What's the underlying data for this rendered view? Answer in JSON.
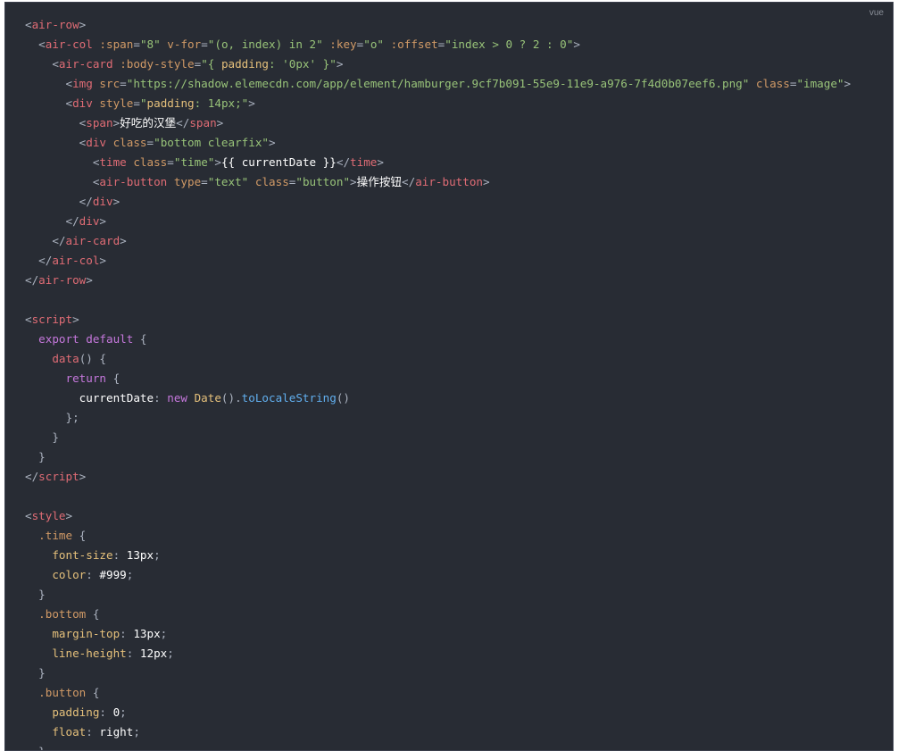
{
  "code_block": {
    "language_label": "vue",
    "colors": {
      "background": "#282c34",
      "tag": "#e06c75",
      "attribute": "#d19a66",
      "string": "#98c379",
      "keyword": "#c678dd",
      "function": "#61afef",
      "property": "#e5c07b",
      "plain": "#abb2bf",
      "text": "#ffffff"
    },
    "lines": [
      [
        [
          "p",
          "<"
        ],
        [
          "tag",
          "air-row"
        ],
        [
          "p",
          ">"
        ]
      ],
      [
        [
          "p",
          "  <"
        ],
        [
          "tag",
          "air-col"
        ],
        [
          "p",
          " "
        ],
        [
          "attr",
          ":span"
        ],
        [
          "p",
          "="
        ],
        [
          "str",
          "\"8\""
        ],
        [
          "p",
          " "
        ],
        [
          "attr",
          "v-for"
        ],
        [
          "p",
          "="
        ],
        [
          "str",
          "\"(o, index) in 2\""
        ],
        [
          "p",
          " "
        ],
        [
          "attr",
          ":key"
        ],
        [
          "p",
          "="
        ],
        [
          "str",
          "\"o\""
        ],
        [
          "p",
          " "
        ],
        [
          "attr",
          ":offset"
        ],
        [
          "p",
          "="
        ],
        [
          "str",
          "\"index > 0 ? 2 : 0\""
        ],
        [
          "p",
          ">"
        ]
      ],
      [
        [
          "p",
          "    <"
        ],
        [
          "tag",
          "air-card"
        ],
        [
          "p",
          " "
        ],
        [
          "attr",
          ":body-style"
        ],
        [
          "p",
          "="
        ],
        [
          "str",
          "\"{ "
        ],
        [
          "prop",
          "padding"
        ],
        [
          "str",
          ": '0px' }\""
        ],
        [
          "p",
          ">"
        ]
      ],
      [
        [
          "p",
          "      <"
        ],
        [
          "tag",
          "img"
        ],
        [
          "p",
          " "
        ],
        [
          "attr",
          "src"
        ],
        [
          "p",
          "="
        ],
        [
          "str",
          "\"https://shadow.elemecdn.com/app/element/hamburger.9cf7b091-55e9-11e9-a976-7f4d0b07eef6.png\""
        ],
        [
          "p",
          " "
        ],
        [
          "attr",
          "class"
        ],
        [
          "p",
          "="
        ],
        [
          "str",
          "\"image\""
        ],
        [
          "p",
          ">"
        ]
      ],
      [
        [
          "p",
          "      <"
        ],
        [
          "tag",
          "div"
        ],
        [
          "p",
          " "
        ],
        [
          "attr",
          "style"
        ],
        [
          "p",
          "="
        ],
        [
          "str",
          "\""
        ],
        [
          "prop",
          "padding"
        ],
        [
          "str",
          ": 14px;\""
        ],
        [
          "p",
          ">"
        ]
      ],
      [
        [
          "p",
          "        <"
        ],
        [
          "tag",
          "span"
        ],
        [
          "p",
          ">"
        ],
        [
          "text",
          "好吃的汉堡"
        ],
        [
          "p",
          "</"
        ],
        [
          "tag",
          "span"
        ],
        [
          "p",
          ">"
        ]
      ],
      [
        [
          "p",
          "        <"
        ],
        [
          "tag",
          "div"
        ],
        [
          "p",
          " "
        ],
        [
          "attr",
          "class"
        ],
        [
          "p",
          "="
        ],
        [
          "str",
          "\"bottom clearfix\""
        ],
        [
          "p",
          ">"
        ]
      ],
      [
        [
          "p",
          "          <"
        ],
        [
          "tag",
          "time"
        ],
        [
          "p",
          " "
        ],
        [
          "attr",
          "class"
        ],
        [
          "p",
          "="
        ],
        [
          "str",
          "\"time\""
        ],
        [
          "p",
          ">"
        ],
        [
          "text",
          "{{ currentDate }}"
        ],
        [
          "p",
          "</"
        ],
        [
          "tag",
          "time"
        ],
        [
          "p",
          ">"
        ]
      ],
      [
        [
          "p",
          "          <"
        ],
        [
          "tag",
          "air-button"
        ],
        [
          "p",
          " "
        ],
        [
          "attr",
          "type"
        ],
        [
          "p",
          "="
        ],
        [
          "str",
          "\"text\""
        ],
        [
          "p",
          " "
        ],
        [
          "attr",
          "class"
        ],
        [
          "p",
          "="
        ],
        [
          "str",
          "\"button\""
        ],
        [
          "p",
          ">"
        ],
        [
          "text",
          "操作按钮"
        ],
        [
          "p",
          "</"
        ],
        [
          "tag",
          "air-button"
        ],
        [
          "p",
          ">"
        ]
      ],
      [
        [
          "p",
          "        </"
        ],
        [
          "tag",
          "div"
        ],
        [
          "p",
          ">"
        ]
      ],
      [
        [
          "p",
          "      </"
        ],
        [
          "tag",
          "div"
        ],
        [
          "p",
          ">"
        ]
      ],
      [
        [
          "p",
          "    </"
        ],
        [
          "tag",
          "air-card"
        ],
        [
          "p",
          ">"
        ]
      ],
      [
        [
          "p",
          "  </"
        ],
        [
          "tag",
          "air-col"
        ],
        [
          "p",
          ">"
        ]
      ],
      [
        [
          "p",
          "</"
        ],
        [
          "tag",
          "air-row"
        ],
        [
          "p",
          ">"
        ]
      ],
      [
        [
          "p",
          ""
        ]
      ],
      [
        [
          "p",
          "<"
        ],
        [
          "tag",
          "script"
        ],
        [
          "p",
          ">"
        ]
      ],
      [
        [
          "kw",
          "  export"
        ],
        [
          "p",
          " "
        ],
        [
          "kw",
          "default"
        ],
        [
          "p",
          " {"
        ]
      ],
      [
        [
          "p",
          "    "
        ],
        [
          "tag",
          "data"
        ],
        [
          "p",
          "() {"
        ]
      ],
      [
        [
          "kw",
          "      return"
        ],
        [
          "p",
          " {"
        ]
      ],
      [
        [
          "text",
          "        currentDate"
        ],
        [
          "p",
          ": "
        ],
        [
          "kw",
          "new"
        ],
        [
          "p",
          " "
        ],
        [
          "prop",
          "Date"
        ],
        [
          "p",
          "()."
        ],
        [
          "fn",
          "toLocaleString"
        ],
        [
          "p",
          "()"
        ]
      ],
      [
        [
          "p",
          "      };"
        ]
      ],
      [
        [
          "p",
          "    }"
        ]
      ],
      [
        [
          "p",
          "  }"
        ]
      ],
      [
        [
          "p",
          "</"
        ],
        [
          "tag",
          "script"
        ],
        [
          "p",
          ">"
        ]
      ],
      [
        [
          "p",
          ""
        ]
      ],
      [
        [
          "p",
          "<"
        ],
        [
          "tag",
          "style"
        ],
        [
          "p",
          ">"
        ]
      ],
      [
        [
          "sel",
          "  .time"
        ],
        [
          "p",
          " {"
        ]
      ],
      [
        [
          "prop",
          "    font-size"
        ],
        [
          "p",
          ": "
        ],
        [
          "text",
          "13px"
        ],
        [
          "p",
          ";"
        ]
      ],
      [
        [
          "prop",
          "    color"
        ],
        [
          "p",
          ": "
        ],
        [
          "text",
          "#999"
        ],
        [
          "p",
          ";"
        ]
      ],
      [
        [
          "p",
          "  }"
        ]
      ],
      [
        [
          "sel",
          "  .bottom"
        ],
        [
          "p",
          " {"
        ]
      ],
      [
        [
          "prop",
          "    margin-top"
        ],
        [
          "p",
          ": "
        ],
        [
          "text",
          "13px"
        ],
        [
          "p",
          ";"
        ]
      ],
      [
        [
          "prop",
          "    line-height"
        ],
        [
          "p",
          ": "
        ],
        [
          "text",
          "12px"
        ],
        [
          "p",
          ";"
        ]
      ],
      [
        [
          "p",
          "  }"
        ]
      ],
      [
        [
          "sel",
          "  .button"
        ],
        [
          "p",
          " {"
        ]
      ],
      [
        [
          "prop",
          "    padding"
        ],
        [
          "p",
          ": "
        ],
        [
          "text",
          "0"
        ],
        [
          "p",
          ";"
        ]
      ],
      [
        [
          "prop",
          "    float"
        ],
        [
          "p",
          ": "
        ],
        [
          "text",
          "right"
        ],
        [
          "p",
          ";"
        ]
      ],
      [
        [
          "p",
          "  }"
        ]
      ]
    ]
  }
}
